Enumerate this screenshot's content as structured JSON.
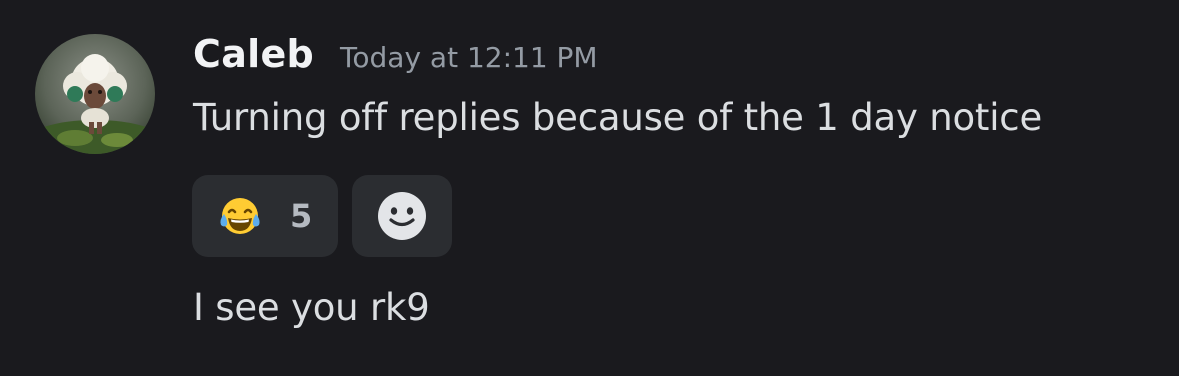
{
  "message": {
    "author": "Caleb",
    "timestamp": "Today at 12:11 PM",
    "content": "Turning off replies because of the 1 day notice",
    "reactions": [
      {
        "emoji_icon": "face-with-tears-of-joy-icon",
        "count": "5"
      }
    ],
    "add_reaction_icon": "smiley-add-reaction-icon"
  },
  "next_message": {
    "content": "I see you rk9"
  },
  "colors": {
    "background": "#1a1a1e",
    "username": "#f2f3f5",
    "timestamp": "#949ba4",
    "text": "#dbdee1",
    "reaction_bg": "#2b2d31",
    "reaction_count": "#b5bac1"
  }
}
